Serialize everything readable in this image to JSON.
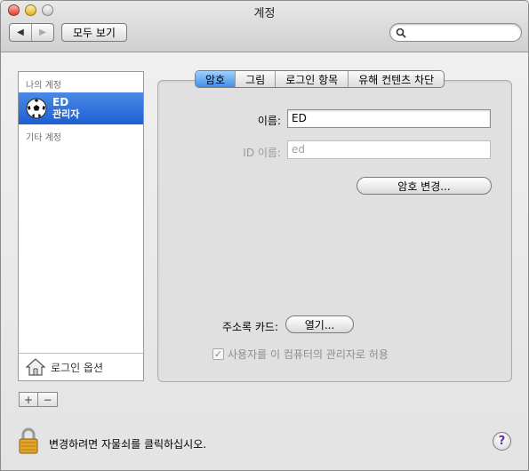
{
  "window": {
    "title": "계정"
  },
  "toolbar": {
    "show_all_label": "모두 보기",
    "search_value": "",
    "search_placeholder": ""
  },
  "sidebar": {
    "my_accounts_label": "나의 계정",
    "accounts": [
      {
        "name": "ED",
        "role": "관리자",
        "selected": true
      }
    ],
    "other_accounts_label": "기타 계정",
    "login_options_label": "로그인 옵션",
    "add_label": "+",
    "remove_label": "−"
  },
  "tabs": [
    {
      "label": "암호",
      "active": true
    },
    {
      "label": "그림",
      "active": false
    },
    {
      "label": "로그인 항목",
      "active": false
    },
    {
      "label": "유해 컨텐츠 차단",
      "active": false
    }
  ],
  "password_tab": {
    "name_label": "이름:",
    "name_value": "ED",
    "id_label": "ID 이름:",
    "id_value": "ed",
    "change_password_label": "암호 변경...",
    "address_card_label": "주소록 카드:",
    "open_label": "열기...",
    "admin_checkbox_label": "사용자를 이 컴퓨터의 관리자로 허용",
    "admin_checked": true
  },
  "footer": {
    "lock_text": "변경하려면 자물쇠를 클릭하십시오.",
    "help_label": "?"
  },
  "colors": {
    "selection": "#2a6ad8",
    "tab_active": "#5aa2ee"
  }
}
